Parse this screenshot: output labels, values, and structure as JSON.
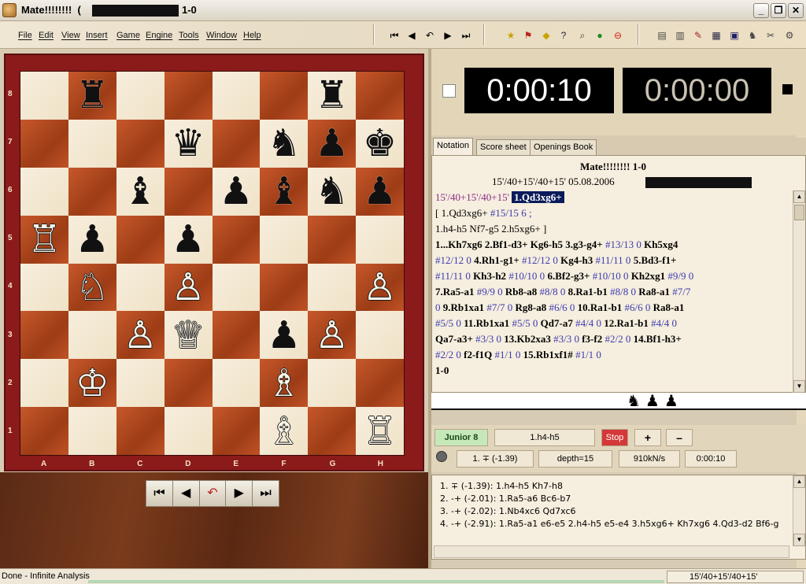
{
  "window": {
    "title": "Mate!!!!!!!!  (",
    "result": "1-0",
    "min": "_",
    "max": "❐",
    "close": "✕"
  },
  "menu": [
    "File",
    "Edit",
    "View",
    "Insert",
    "Game",
    "Engine",
    "Tools",
    "Window",
    "Help"
  ],
  "board": {
    "ranks": [
      "8",
      "7",
      "6",
      "5",
      "4",
      "3",
      "2",
      "1"
    ],
    "files": [
      "A",
      "B",
      "C",
      "D",
      "E",
      "F",
      "G",
      "H"
    ],
    "position": [
      [
        "",
        "bR",
        "",
        "",
        "",
        "",
        "bR",
        ""
      ],
      [
        "",
        "",
        "",
        "bQ",
        "",
        "bN",
        "bP",
        "bK"
      ],
      [
        "",
        "",
        "bB",
        "",
        "bP",
        "bB",
        "bN",
        "bP"
      ],
      [
        "wR",
        "bP",
        "",
        "bP",
        "",
        "",
        "",
        ""
      ],
      [
        "",
        "wN",
        "",
        "wP",
        "",
        "",
        "",
        "wP"
      ],
      [
        "",
        "",
        "wP",
        "wQ",
        "",
        "bP",
        "wP",
        ""
      ],
      [
        "",
        "wK",
        "",
        "",
        "",
        "wB",
        "",
        ""
      ],
      [
        "",
        "",
        "",
        "",
        "",
        "wB",
        "",
        "wR"
      ]
    ],
    "piece_glyphs": {
      "wK": "♔",
      "wQ": "♕",
      "wR": "♖",
      "wB": "♗",
      "wN": "♘",
      "wP": "♙",
      "bK": "♚",
      "bQ": "♛",
      "bR": "♜",
      "bB": "♝",
      "bN": "♞",
      "bP": "♟"
    }
  },
  "nav": [
    "⏮",
    "◀",
    "↶",
    "▶",
    "⏭"
  ],
  "clocks": {
    "white": "0:00:10",
    "black": "0:00:00"
  },
  "tabs": [
    "Notation",
    "Score sheet",
    "Openings Book"
  ],
  "notation": {
    "title": "Mate!!!!!!!!  1-0",
    "subtitle": "15'/40+15'/40+15'  05.08.2006",
    "lines": [
      [
        {
          "t": "15'/40+15'/40+15'  ",
          "c": "hdr"
        },
        {
          "t": "1.Qd3xg6+",
          "c": "cur"
        }
      ],
      [
        {
          "t": "  [ 1.Qd3xg6+ ",
          "c": ""
        },
        {
          "t": "#15/15",
          "c": "ev"
        },
        {
          "t": "  6 ;",
          "c": "ev"
        }
      ],
      [
        {
          "t": "  1.h4-h5  Nf7-g5  2.h5xg6+ ]",
          "c": ""
        }
      ],
      [
        {
          "t": "1...Kh7xg6  2.Bf1-d3+  Kg6-h5  3.g3-g4+  ",
          "c": "mv"
        },
        {
          "t": "#13/13  0  ",
          "c": "ev"
        },
        {
          "t": "Kh5xg4",
          "c": "mv"
        }
      ],
      [
        {
          "t": "#12/12  0  ",
          "c": "ev"
        },
        {
          "t": "4.Rh1-g1+  ",
          "c": "mv"
        },
        {
          "t": "#12/12  0  ",
          "c": "ev"
        },
        {
          "t": "Kg4-h3  ",
          "c": "mv"
        },
        {
          "t": "#11/11  0  ",
          "c": "ev"
        },
        {
          "t": "5.Bd3-f1+",
          "c": "mv"
        }
      ],
      [
        {
          "t": "#11/11  0  ",
          "c": "ev"
        },
        {
          "t": "Kh3-h2  ",
          "c": "mv"
        },
        {
          "t": "#10/10  0  ",
          "c": "ev"
        },
        {
          "t": "6.Bf2-g3+  ",
          "c": "mv"
        },
        {
          "t": "#10/10  0  ",
          "c": "ev"
        },
        {
          "t": "Kh2xg1  ",
          "c": "mv"
        },
        {
          "t": "#9/9  0",
          "c": "ev"
        }
      ],
      [
        {
          "t": "7.Ra5-a1  ",
          "c": "mv"
        },
        {
          "t": "#9/9  0  ",
          "c": "ev"
        },
        {
          "t": "Rb8-a8  ",
          "c": "mv"
        },
        {
          "t": "#8/8  0  ",
          "c": "ev"
        },
        {
          "t": "8.Ra1-b1  ",
          "c": "mv"
        },
        {
          "t": "#8/8  0  ",
          "c": "ev"
        },
        {
          "t": "Ra8-a1  ",
          "c": "mv"
        },
        {
          "t": "#7/7",
          "c": "ev"
        }
      ],
      [
        {
          "t": "0  ",
          "c": "ev"
        },
        {
          "t": "9.Rb1xa1  ",
          "c": "mv"
        },
        {
          "t": "#7/7  0  ",
          "c": "ev"
        },
        {
          "t": "Rg8-a8  ",
          "c": "mv"
        },
        {
          "t": "#6/6  0  ",
          "c": "ev"
        },
        {
          "t": "10.Ra1-b1  ",
          "c": "mv"
        },
        {
          "t": "#6/6  0  ",
          "c": "ev"
        },
        {
          "t": "Ra8-a1",
          "c": "mv"
        }
      ],
      [
        {
          "t": "#5/5  0  ",
          "c": "ev"
        },
        {
          "t": "11.Rb1xa1  ",
          "c": "mv"
        },
        {
          "t": "#5/5  0  ",
          "c": "ev"
        },
        {
          "t": "Qd7-a7  ",
          "c": "mv"
        },
        {
          "t": "#4/4  0  ",
          "c": "ev"
        },
        {
          "t": "12.Ra1-b1  ",
          "c": "mv"
        },
        {
          "t": "#4/4  0",
          "c": "ev"
        }
      ],
      [
        {
          "t": "Qa7-a3+  ",
          "c": "mv"
        },
        {
          "t": "#3/3  0  ",
          "c": "ev"
        },
        {
          "t": "13.Kb2xa3  ",
          "c": "mv"
        },
        {
          "t": "#3/3  0  ",
          "c": "ev"
        },
        {
          "t": "f3-f2  ",
          "c": "mv"
        },
        {
          "t": "#2/2  0  ",
          "c": "ev"
        },
        {
          "t": "14.Bf1-h3+",
          "c": "mv"
        }
      ],
      [
        {
          "t": "#2/2  0  ",
          "c": "ev"
        },
        {
          "t": "f2-f1Q  ",
          "c": "mv"
        },
        {
          "t": "#1/1  0  ",
          "c": "ev"
        },
        {
          "t": "15.Rb1xf1#  ",
          "c": "mv"
        },
        {
          "t": "#1/1  0",
          "c": "ev"
        }
      ],
      [
        {
          "t": "1-0",
          "c": "mv"
        }
      ]
    ]
  },
  "captured": "♞♟♟",
  "engine": {
    "name": "Junior 8",
    "line": "1.h4-h5",
    "stop": "Stop",
    "plus": "+",
    "minus": "–",
    "eval": "1. ∓ (-1.39)",
    "depth": "depth=15",
    "speed": "910kN/s",
    "time": "0:00:10"
  },
  "analysis": [
    "1. ∓ (-1.39): 1.h4-h5 Kh7-h8",
    "2. -+ (-2.01): 1.Ra5-a6 Bc6-b7",
    "3. -+ (-2.02): 1.Nb4xc6 Qd7xc6",
    "4. -+ (-2.91): 1.Ra5-a1 e6-e5 2.h4-h5 e5-e4 3.h5xg6+ Kh7xg6 4.Qd3-d2 Bf6-g"
  ],
  "status": {
    "left": "Done - Infinite Analysis",
    "right": "15'/40+15'/40+15'"
  }
}
